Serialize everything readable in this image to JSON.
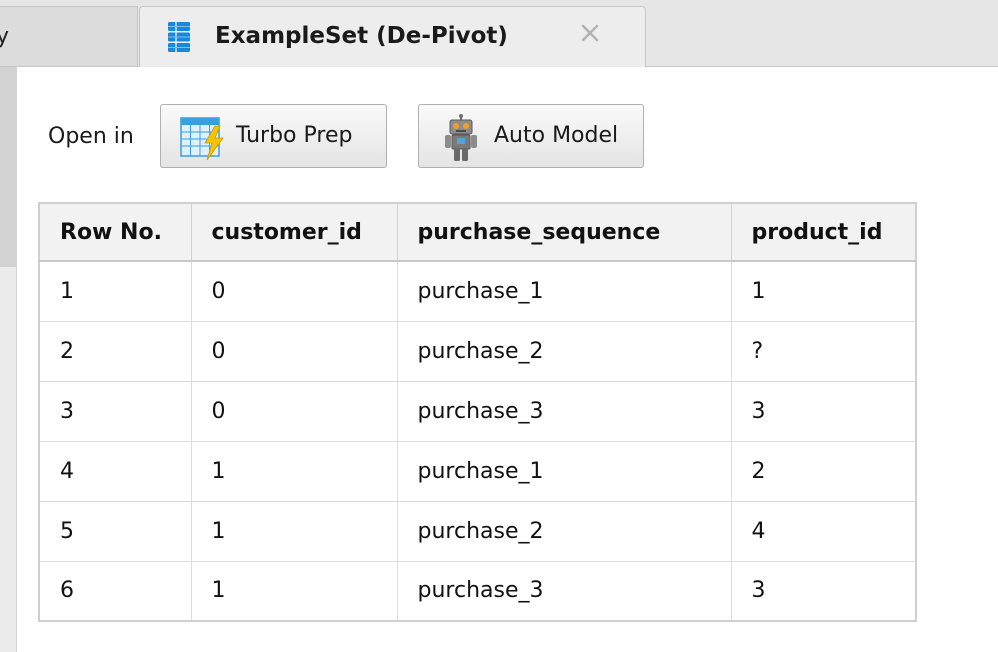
{
  "tabs": {
    "previous": {
      "label": "y"
    },
    "active": {
      "title": "ExampleSet (De-Pivot)",
      "icon": "data-table-icon",
      "close_icon": "close-icon"
    }
  },
  "toolbar": {
    "open_in_label": "Open in",
    "turbo_prep": {
      "label": "Turbo Prep",
      "icon": "turbo-prep-icon"
    },
    "auto_model": {
      "label": "Auto Model",
      "icon": "robot-icon"
    }
  },
  "table": {
    "columns": [
      "Row No.",
      "customer_id",
      "purchase_sequence",
      "product_id"
    ],
    "rows": [
      [
        "1",
        "0",
        "purchase_1",
        "1"
      ],
      [
        "2",
        "0",
        "purchase_2",
        "?"
      ],
      [
        "3",
        "0",
        "purchase_3",
        "3"
      ],
      [
        "4",
        "1",
        "purchase_1",
        "2"
      ],
      [
        "5",
        "1",
        "purchase_2",
        "4"
      ],
      [
        "6",
        "1",
        "purchase_3",
        "3"
      ]
    ]
  },
  "colors": {
    "tab_strip": "#e6e6e6",
    "active_tab": "#ededed",
    "icon_blue": "#1a88d8",
    "bolt_yellow": "#f5c400",
    "header_bg": "#f2f2f2",
    "border": "#d0d0d0"
  }
}
